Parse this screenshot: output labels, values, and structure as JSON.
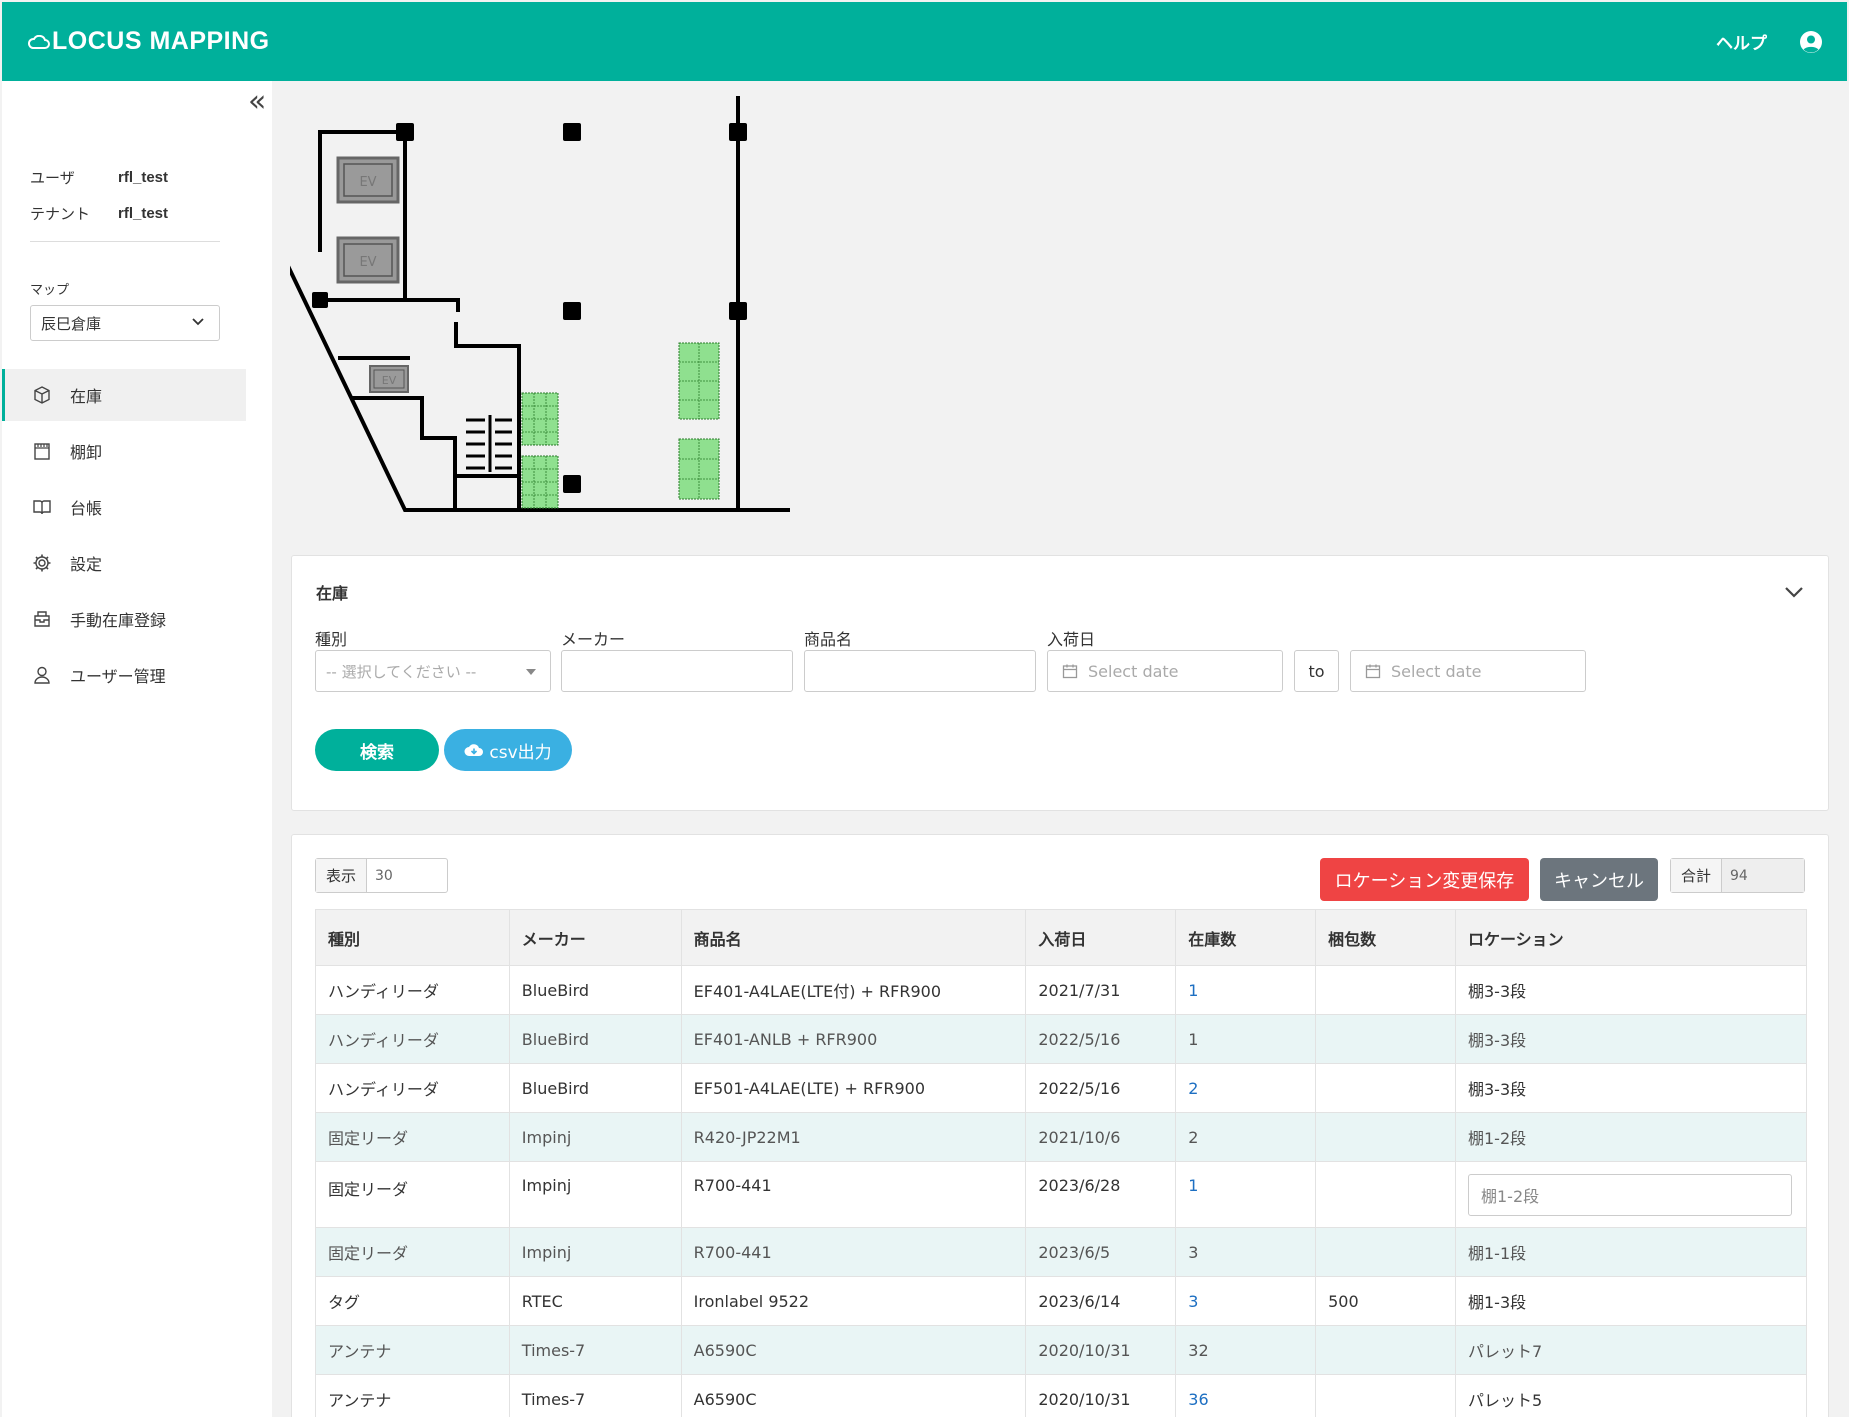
{
  "header": {
    "app_title": "LOCUS MAPPING",
    "help_label": "ヘルプ"
  },
  "sidebar": {
    "user_label": "ユーザ",
    "user_value": "rfl_test",
    "tenant_label": "テナント",
    "tenant_value": "rfl_test",
    "map_label": "マップ",
    "map_selected": "辰巳倉庫",
    "nav": [
      {
        "label": "在庫",
        "icon": "box-icon",
        "active": true
      },
      {
        "label": "棚卸",
        "icon": "calendar-icon",
        "active": false
      },
      {
        "label": "台帳",
        "icon": "book-icon",
        "active": false
      },
      {
        "label": "設定",
        "icon": "gear-icon",
        "active": false
      },
      {
        "label": "手動在庫登録",
        "icon": "inbox-icon",
        "active": false
      },
      {
        "label": "ユーザー管理",
        "icon": "user-icon",
        "active": false
      }
    ]
  },
  "map": {
    "elevator_label": "EV"
  },
  "search": {
    "title": "在庫",
    "type_label": "種別",
    "type_placeholder": "-- 選択してください --",
    "maker_label": "メーカー",
    "product_label": "商品名",
    "arrival_label": "入荷日",
    "date_from_placeholder": "Select date",
    "to_label": "to",
    "date_to_placeholder": "Select date",
    "search_button": "検索",
    "csv_button": "csv出力"
  },
  "table": {
    "show_label": "表示",
    "show_value": "30",
    "save_button": "ロケーション変更保存",
    "cancel_button": "キャンセル",
    "total_label": "合計",
    "total_value": "94",
    "columns": [
      "種別",
      "メーカー",
      "商品名",
      "入荷日",
      "在庫数",
      "梱包数",
      "ロケーション"
    ],
    "rows": [
      {
        "type": "ハンディリーダ",
        "maker": "BlueBird",
        "product": "EF401-A4LAE(LTE付) + RFR900",
        "date": "2021/7/31",
        "stock": "1",
        "pack": "",
        "location": "棚3-3段"
      },
      {
        "type": "ハンディリーダ",
        "maker": "BlueBird",
        "product": "EF401-ANLB + RFR900",
        "date": "2022/5/16",
        "stock": "1",
        "pack": "",
        "location": "棚3-3段"
      },
      {
        "type": "ハンディリーダ",
        "maker": "BlueBird",
        "product": "EF501-A4LAE(LTE) + RFR900",
        "date": "2022/5/16",
        "stock": "2",
        "pack": "",
        "location": "棚3-3段"
      },
      {
        "type": "固定リーダ",
        "maker": "Impinj",
        "product": "R420-JP22M1",
        "date": "2021/10/6",
        "stock": "2",
        "pack": "",
        "location": "棚1-2段"
      },
      {
        "type": "固定リーダ",
        "maker": "Impinj",
        "product": "R700-441",
        "date": "2023/6/28",
        "stock": "1",
        "pack": "",
        "location": "棚1-2段",
        "editing": true
      },
      {
        "type": "固定リーダ",
        "maker": "Impinj",
        "product": "R700-441",
        "date": "2023/6/5",
        "stock": "3",
        "pack": "",
        "location": "棚1-1段"
      },
      {
        "type": "タグ",
        "maker": "RTEC",
        "product": "Ironlabel 9522",
        "date": "2023/6/14",
        "stock": "3",
        "pack": "500",
        "location": "棚1-3段"
      },
      {
        "type": "アンテナ",
        "maker": "Times-7",
        "product": "A6590C",
        "date": "2020/10/31",
        "stock": "32",
        "pack": "",
        "location": "パレット7"
      },
      {
        "type": "アンテナ",
        "maker": "Times-7",
        "product": "A6590C",
        "date": "2020/10/31",
        "stock": "36",
        "pack": "",
        "location": "パレット5"
      }
    ]
  },
  "colors": {
    "brand": "#00b09b",
    "danger": "#ef4444",
    "info": "#3ab0e2",
    "secondary": "#6c757d",
    "link": "#1d6fc2"
  }
}
